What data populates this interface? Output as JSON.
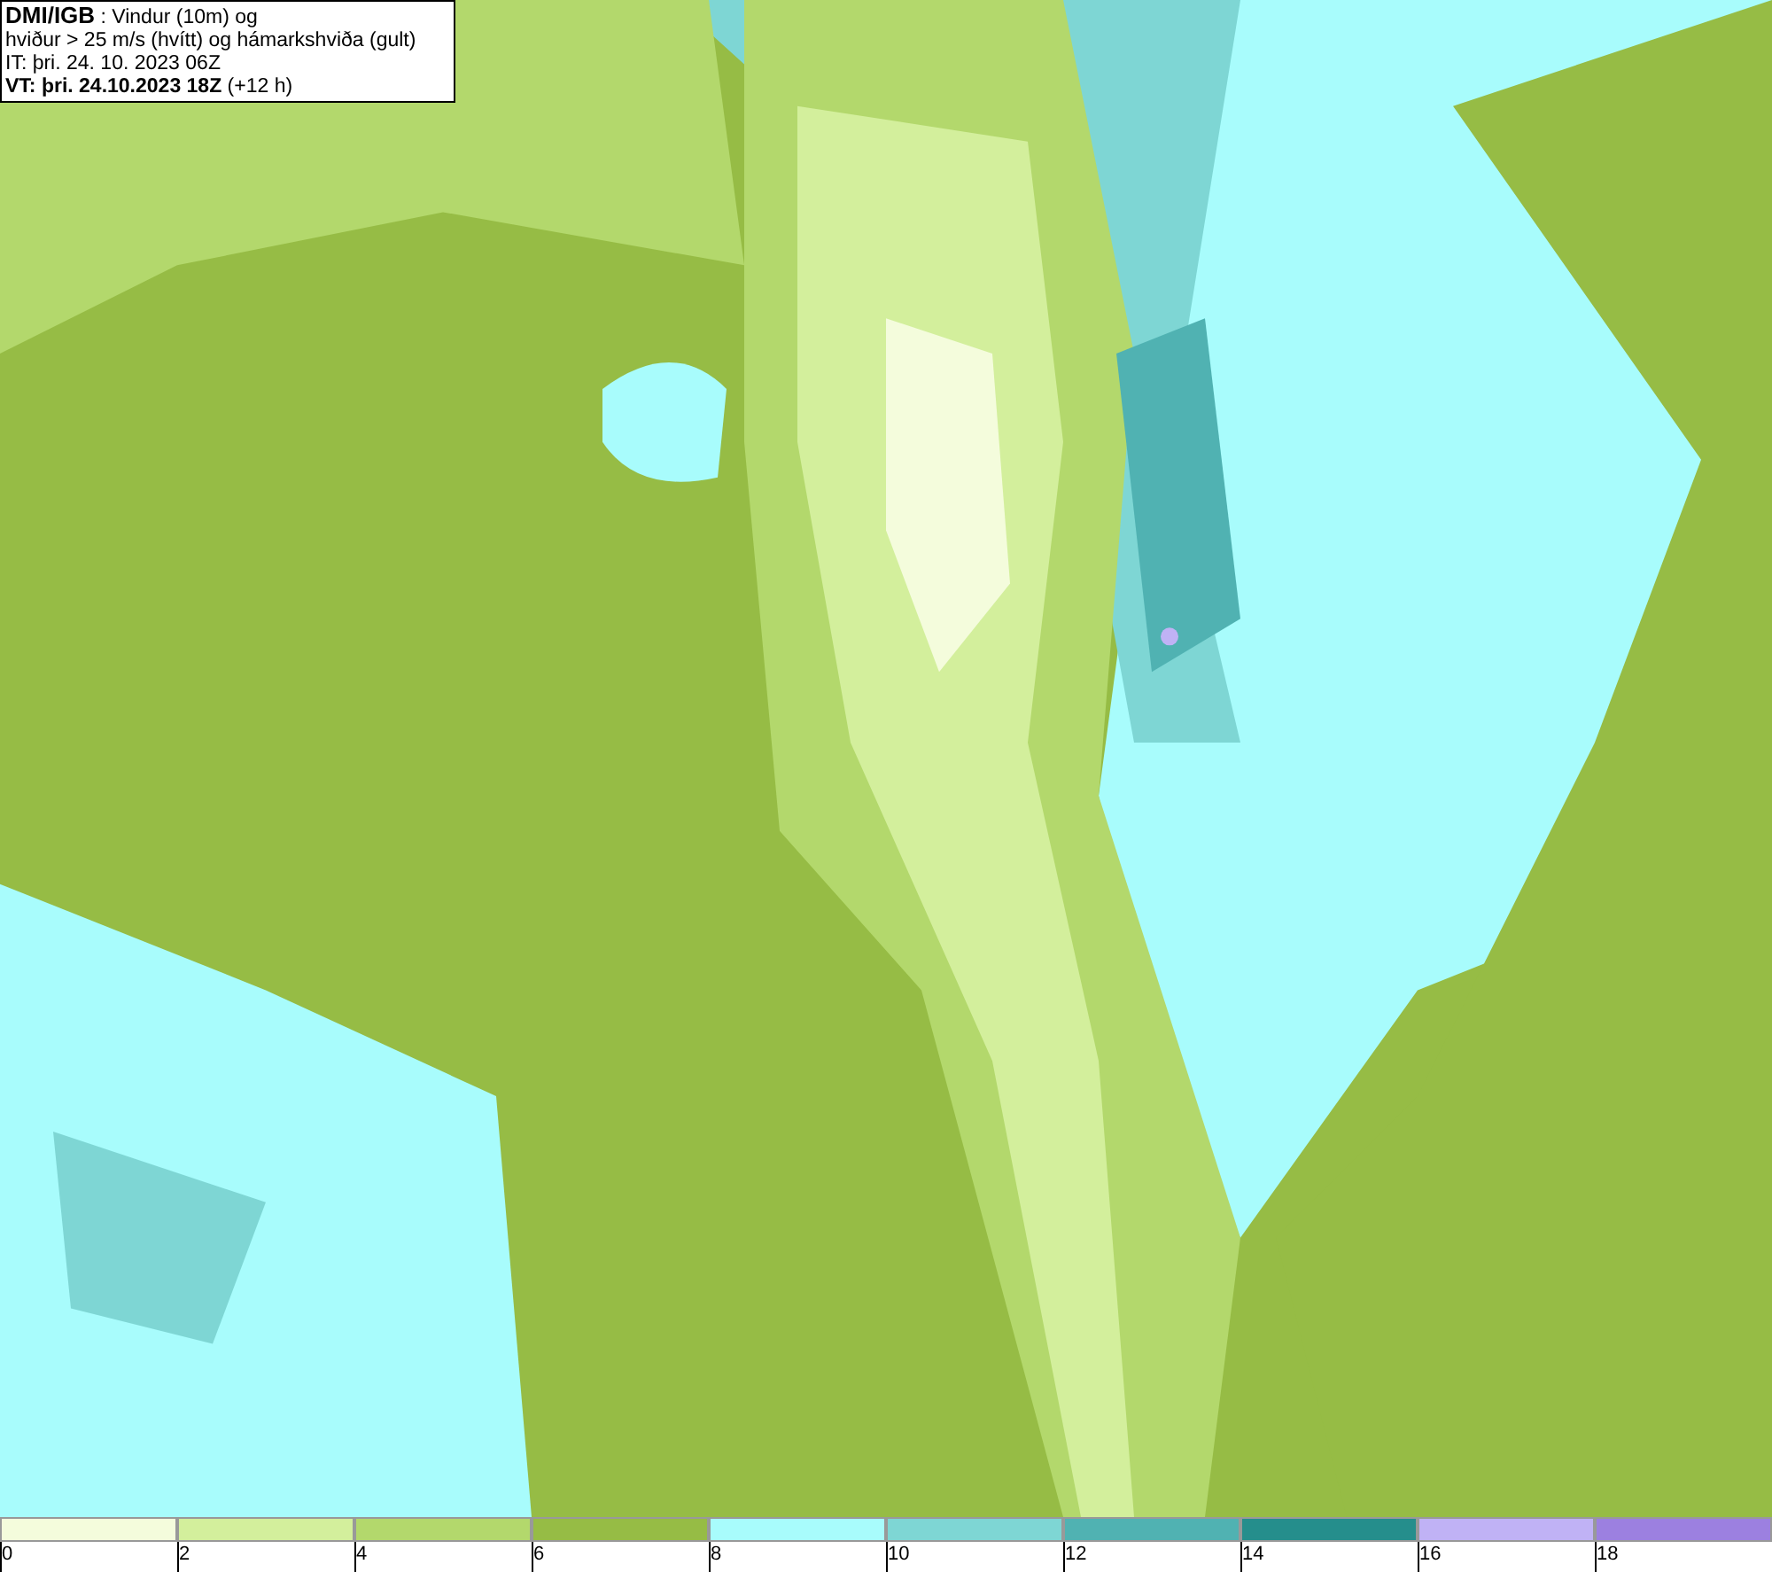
{
  "header": {
    "source": "DMI/IGB",
    "title": " : Vindur (10m) og",
    "line_2": "hviður > 25 m/s (hvítt) og hámarkshviða (gult)",
    "line_3": "IT: þri. 24. 10. 2023 06Z",
    "valid_bold": "VT: þri. 24.10.2023 18Z",
    "valid_rest": " (+12 h)"
  },
  "legend": [
    {
      "label": "0",
      "color": "#f4fcdc"
    },
    {
      "label": "2",
      "color": "#d3ef9c"
    },
    {
      "label": "4",
      "color": "#b3d86c"
    },
    {
      "label": "6",
      "color": "#96bc45"
    },
    {
      "label": "8",
      "color": "#a8fcfc"
    },
    {
      "label": "10",
      "color": "#7ed6d4"
    },
    {
      "label": "12",
      "color": "#50b2b2"
    },
    {
      "label": "14",
      "color": "#258e8c"
    },
    {
      "label": "16",
      "color": "#c0b2f5"
    },
    {
      "label": "18",
      "color": "#9c80e0"
    }
  ]
}
